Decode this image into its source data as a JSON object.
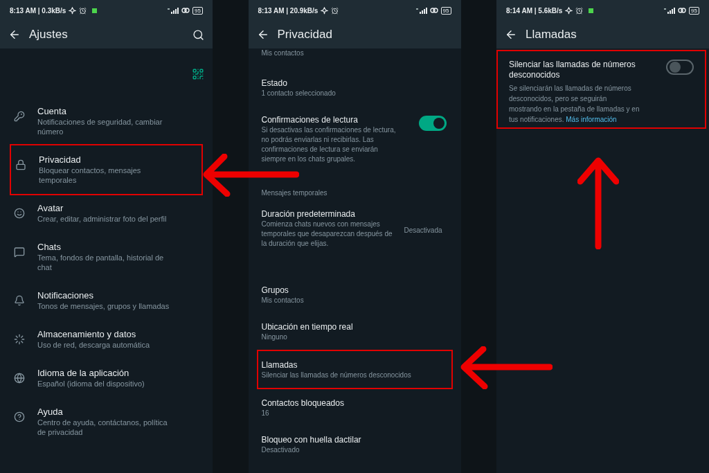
{
  "settings": {
    "status_text": "8:13 AM | 0.3kB/s",
    "notification_dot": true,
    "battery": "95",
    "title": "Ajustes",
    "items": [
      {
        "title": "Cuenta",
        "subtitle": "Notificaciones de seguridad, cambiar número",
        "highlighted": false
      },
      {
        "title": "Privacidad",
        "subtitle": "Bloquear contactos, mensajes temporales",
        "highlighted": true
      },
      {
        "title": "Avatar",
        "subtitle": "Crear, editar, administrar foto del perfil",
        "highlighted": false
      },
      {
        "title": "Chats",
        "subtitle": "Tema, fondos de pantalla, historial de chat",
        "highlighted": false
      },
      {
        "title": "Notificaciones",
        "subtitle": "Tonos de mensajes, grupos y llamadas",
        "highlighted": false
      },
      {
        "title": "Almacenamiento y datos",
        "subtitle": "Uso de red, descarga automática",
        "highlighted": false
      },
      {
        "title": "Idioma de la aplicación",
        "subtitle": "Español (idioma del dispositivo)",
        "highlighted": false
      },
      {
        "title": "Ayuda",
        "subtitle": "Centro de ayuda, contáctanos, política de privacidad",
        "highlighted": false
      }
    ]
  },
  "privacy": {
    "status_text": "8:13 AM | 20.9kB/s",
    "notification_dot": false,
    "battery": "95",
    "title": "Privacidad",
    "items": [
      {
        "kind": "row",
        "subtitle": "Mis contactos",
        "highlighted": false
      },
      {
        "kind": "row",
        "title": "Estado",
        "subtitle": "1 contacto seleccionado",
        "highlighted": false
      },
      {
        "kind": "toggle",
        "title": "Confirmaciones de lectura",
        "subtitle": "Si desactivas las confirmaciones de lectura, no podrás enviarlas ni recibirlas. Las confirmaciones de lectura se enviarán siempre en los chats grupales.",
        "on": true,
        "highlighted": false
      },
      {
        "kind": "section",
        "title": "Mensajes temporales"
      },
      {
        "kind": "value",
        "title": "Duración predeterminada",
        "subtitle": "Comienza chats nuevos con mensajes temporales que desaparezcan después de la duración que elijas.",
        "value": "Desactivada",
        "highlighted": false
      },
      {
        "kind": "row",
        "title": "Grupos",
        "subtitle": "Mis contactos",
        "highlighted": false
      },
      {
        "kind": "row",
        "title": "Ubicación en tiempo real",
        "subtitle": "Ninguno",
        "highlighted": false
      },
      {
        "kind": "row",
        "title": "Llamadas",
        "subtitle": "Silenciar las llamadas de números desconocidos",
        "highlighted": true
      },
      {
        "kind": "row",
        "title": "Contactos bloqueados",
        "subtitle": "16",
        "highlighted": false
      },
      {
        "kind": "row",
        "title": "Bloqueo con huella dactilar",
        "subtitle": "Desactivado",
        "highlighted": false
      }
    ]
  },
  "calls": {
    "status_text": "8:14 AM | 5.6kB/s",
    "notification_dot": true,
    "battery": "95",
    "title": "Llamadas",
    "items": [
      {
        "kind": "toggle",
        "title": "Silenciar las llamadas de números desconocidos",
        "subtitle": "Se silenciarán las llamadas de números desconocidos, pero se seguirán mostrando en la pestaña de llamadas y en tus notificaciones.",
        "link": "Más información",
        "on": false,
        "highlighted": true
      }
    ]
  }
}
